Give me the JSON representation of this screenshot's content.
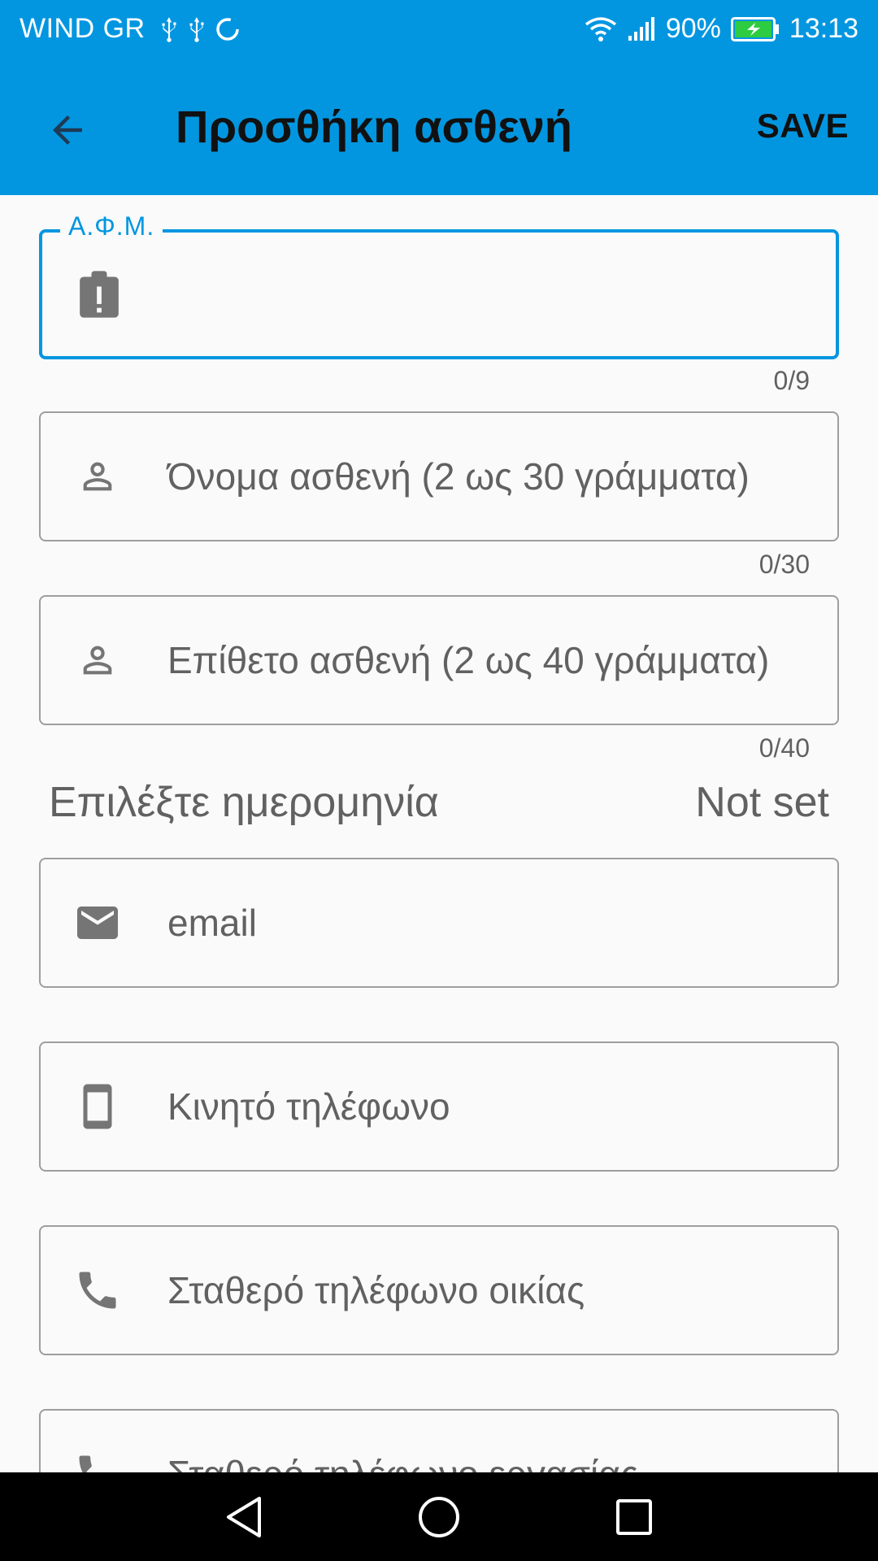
{
  "status_bar": {
    "carrier": "WIND GR",
    "battery": "90%",
    "time": "13:13"
  },
  "app_bar": {
    "title": "Προσθήκη ασθενή",
    "save_label": "SAVE"
  },
  "form": {
    "afm": {
      "label": "Α.Φ.Μ.",
      "value": "",
      "counter": "0/9"
    },
    "first_name": {
      "placeholder": "Όνομα ασθενή (2 ως 30 γράμματα)",
      "counter": "0/30"
    },
    "last_name": {
      "placeholder": "Επίθετο ασθενή (2 ως 40 γράμματα)",
      "counter": "0/40"
    },
    "date": {
      "label": "Επιλέξτε ημερομηνία",
      "value": "Not set"
    },
    "email": {
      "placeholder": "email"
    },
    "mobile": {
      "placeholder": "Κινητό τηλέφωνο"
    },
    "home_phone": {
      "placeholder": "Σταθερό τηλέφωνο οικίας"
    },
    "work_phone": {
      "placeholder": "Σταθερό τηλέφωνο εργασίας"
    }
  },
  "colors": {
    "primary": "#0396e0",
    "icon_gray": "#757575",
    "text_gray": "#616161",
    "border_gray": "#9e9e9e"
  }
}
